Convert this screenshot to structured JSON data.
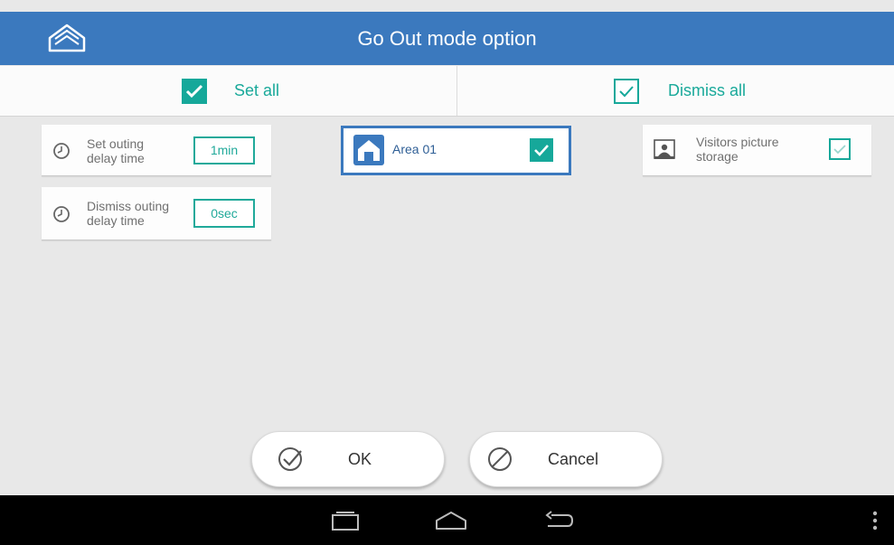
{
  "app": {
    "title": "Go Out mode option"
  },
  "selection": {
    "set_all": "Set all",
    "dismiss_all": "Dismiss all"
  },
  "settings": {
    "set_delay": {
      "label_line1": "Set outing",
      "label_line2": "delay time",
      "value": "1min"
    },
    "dismiss_delay": {
      "label_line1": "Dismiss outing",
      "label_line2": "delay time",
      "value": "0sec"
    }
  },
  "area": {
    "label": "Area 01",
    "checked": true
  },
  "visitors": {
    "label_line1": "Visitors picture",
    "label_line2": "storage",
    "checked": true
  },
  "buttons": {
    "ok": "OK",
    "cancel": "Cancel"
  },
  "colors": {
    "header": "#3b79be",
    "accent": "#16a89a",
    "navbar": "#000000"
  },
  "icons": [
    "home-icon",
    "checkbox-checked-icon",
    "clock-icon",
    "house-icon",
    "picture-icon",
    "checkmark-circle-icon",
    "cancel-circle-icon",
    "recent-apps-icon",
    "android-home-icon",
    "back-icon",
    "overflow-menu-icon"
  ]
}
